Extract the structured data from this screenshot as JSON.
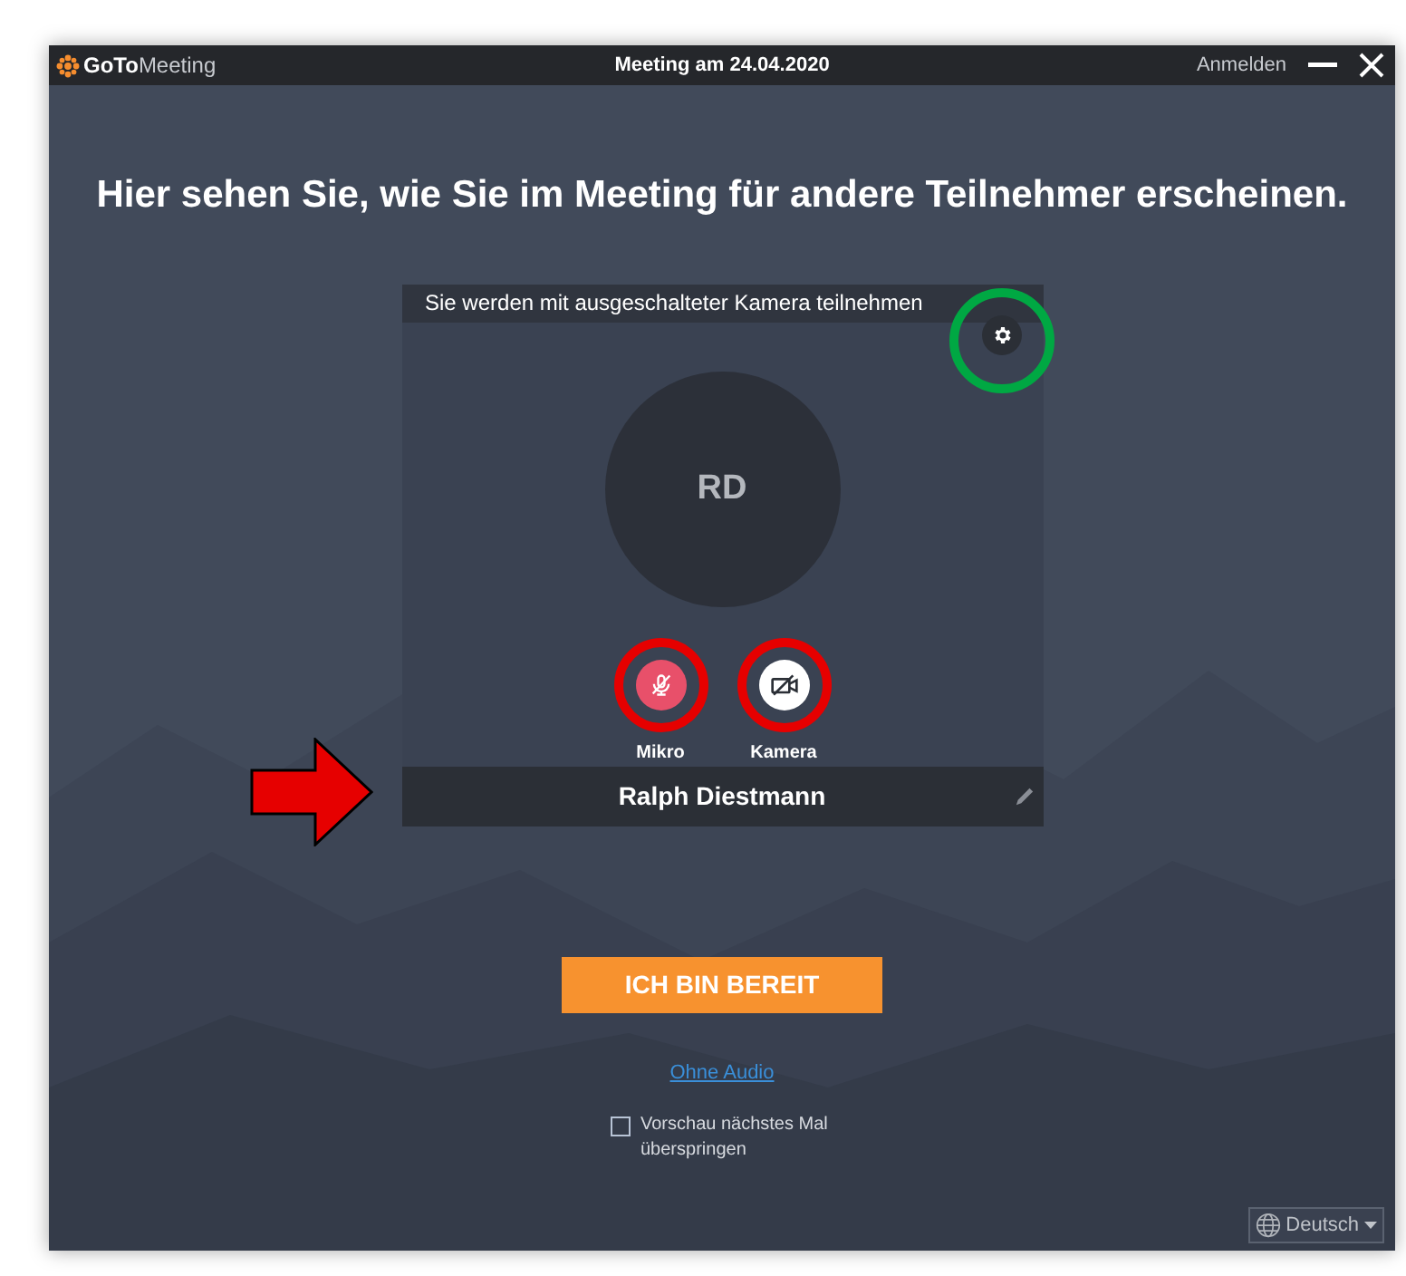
{
  "window": {
    "logo_bold": "GoTo",
    "logo_light": "Meeting",
    "title": "Meeting am 24.04.2020",
    "sign_in": "Anmelden"
  },
  "headline": "Hier sehen Sie, wie Sie im Meeting für andere Teilnehmer erscheinen.",
  "preview": {
    "notice": "Sie werden mit ausgeschalteter Kamera teilnehmen",
    "initials": "RD",
    "controls": [
      {
        "kind": "mic",
        "label": "Mikro",
        "on": false
      },
      {
        "kind": "camera",
        "label": "Kamera",
        "on": false
      }
    ],
    "name": "Ralph Diestmann"
  },
  "ready_button": "ICH BIN BEREIT",
  "no_audio_link": "Ohne Audio",
  "skip_preview": {
    "label": "Vorschau nächstes Mal überspringen",
    "checked": false
  },
  "language": "Deutsch"
}
